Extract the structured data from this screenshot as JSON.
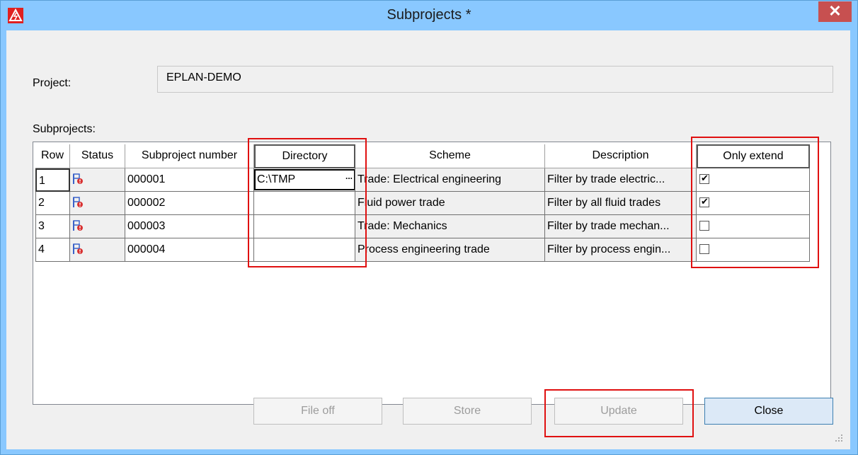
{
  "window": {
    "title": "Subprojects *",
    "close_glyph": "✕"
  },
  "labels": {
    "project_label": "Project:",
    "subprojects_label": "Subprojects:"
  },
  "project": {
    "value": "EPLAN-DEMO"
  },
  "grid": {
    "columns": [
      "Row",
      "Status",
      "Subproject number",
      "Directory",
      "Scheme",
      "Description",
      "Only extend"
    ],
    "rows": [
      {
        "row": "1",
        "status_icon": "subproject-status-icon",
        "number": "000001",
        "directory": "C:\\TMP",
        "scheme": "Trade: Electrical engineering",
        "description": "Filter by trade electric...",
        "only_extend": true
      },
      {
        "row": "2",
        "status_icon": "subproject-status-icon",
        "number": "000002",
        "directory": "",
        "scheme": "Fluid power trade",
        "description": "Filter by all fluid trades",
        "only_extend": true
      },
      {
        "row": "3",
        "status_icon": "subproject-status-icon",
        "number": "000003",
        "directory": "",
        "scheme": "Trade: Mechanics",
        "description": "Filter by trade mechan...",
        "only_extend": false
      },
      {
        "row": "4",
        "status_icon": "subproject-status-icon",
        "number": "000004",
        "directory": "",
        "scheme": "Process engineering trade",
        "description": "Filter by process engin...",
        "only_extend": false
      }
    ],
    "editor_ellipsis": "..."
  },
  "buttons": {
    "file_off": {
      "label": "File off",
      "enabled": false
    },
    "store": {
      "label": "Store",
      "enabled": false
    },
    "update": {
      "label": "Update",
      "enabled": false
    },
    "close": {
      "label": "Close",
      "enabled": true
    }
  },
  "colors": {
    "titlebar": "#89c8ff",
    "close": "#c75050",
    "highlight": "#e01010"
  }
}
